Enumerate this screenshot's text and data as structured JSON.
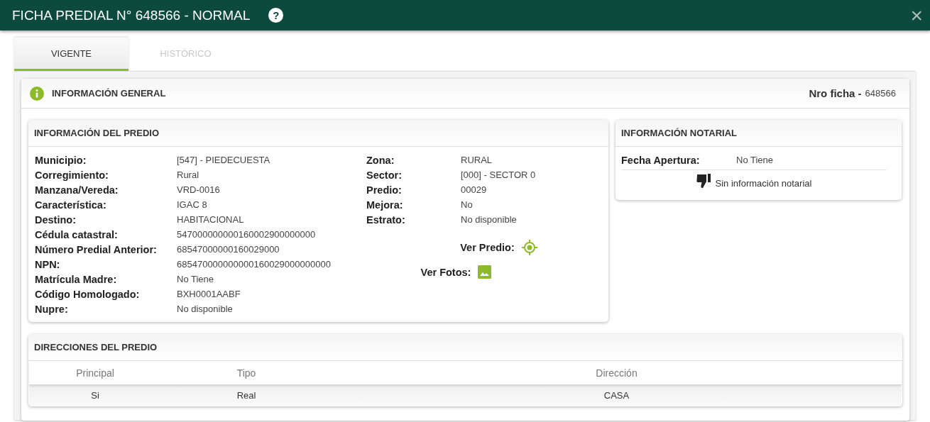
{
  "window": {
    "title": "FICHA PREDIAL N° 648566 - NORMAL",
    "help": "?",
    "close": "×"
  },
  "tabs": [
    {
      "label": "VIGENTE",
      "selected": true
    },
    {
      "label": "HISTÓRICO",
      "selected": false
    }
  ],
  "general": {
    "title": "INFORMACIÓN GENERAL",
    "nro_label": "Nro ficha -",
    "nro_value": "648566"
  },
  "predio": {
    "title": "INFORMACIÓN DEL PREDIO",
    "left": [
      {
        "label": "Municipio:",
        "value": "[547] - PIEDECUESTA"
      },
      {
        "label": "Corregimiento:",
        "value": "Rural"
      },
      {
        "label": "Manzana/Vereda:",
        "value": "VRD-0016"
      },
      {
        "label": "Característica:",
        "value": "IGAC 8"
      },
      {
        "label": "Destino:",
        "value": "HABITACIONAL"
      },
      {
        "label": "Cédula catastral:",
        "value": "547000000000160002900000000"
      },
      {
        "label": "Número Predial Anterior:",
        "value": "68547000000160029000"
      },
      {
        "label": "NPN:",
        "value": "685470000000000160029000000000"
      },
      {
        "label": "Matrícula Madre:",
        "value": "No Tiene"
      },
      {
        "label": "Código Homologado:",
        "value": "BXH0001AABF"
      },
      {
        "label": "Nupre:",
        "value": "No disponible"
      }
    ],
    "right": [
      {
        "label": "Zona:",
        "value": "RURAL"
      },
      {
        "label": "Sector:",
        "value": "[000] - SECTOR 0"
      },
      {
        "label": "Predio:",
        "value": "00029"
      },
      {
        "label": "Mejora:",
        "value": "No"
      },
      {
        "label": "Estrato:",
        "value": "No disponible"
      }
    ],
    "links": [
      {
        "kind": "map",
        "label": "Ver Predio:"
      },
      {
        "kind": "photos",
        "label": "Ver Fotos:"
      }
    ]
  },
  "notarial": {
    "title": "INFORMACIÓN NOTARIAL",
    "fields": [
      {
        "label": "Fecha Apertura:",
        "value": "No Tiene"
      }
    ],
    "empty": "Sin información notarial"
  },
  "direcciones": {
    "title": "DIRECCIONES DEL PREDIO",
    "columns": [
      "Principal",
      "Tipo",
      "Dirección"
    ],
    "rows": [
      [
        "Si",
        "Real",
        "CASA"
      ]
    ]
  }
}
